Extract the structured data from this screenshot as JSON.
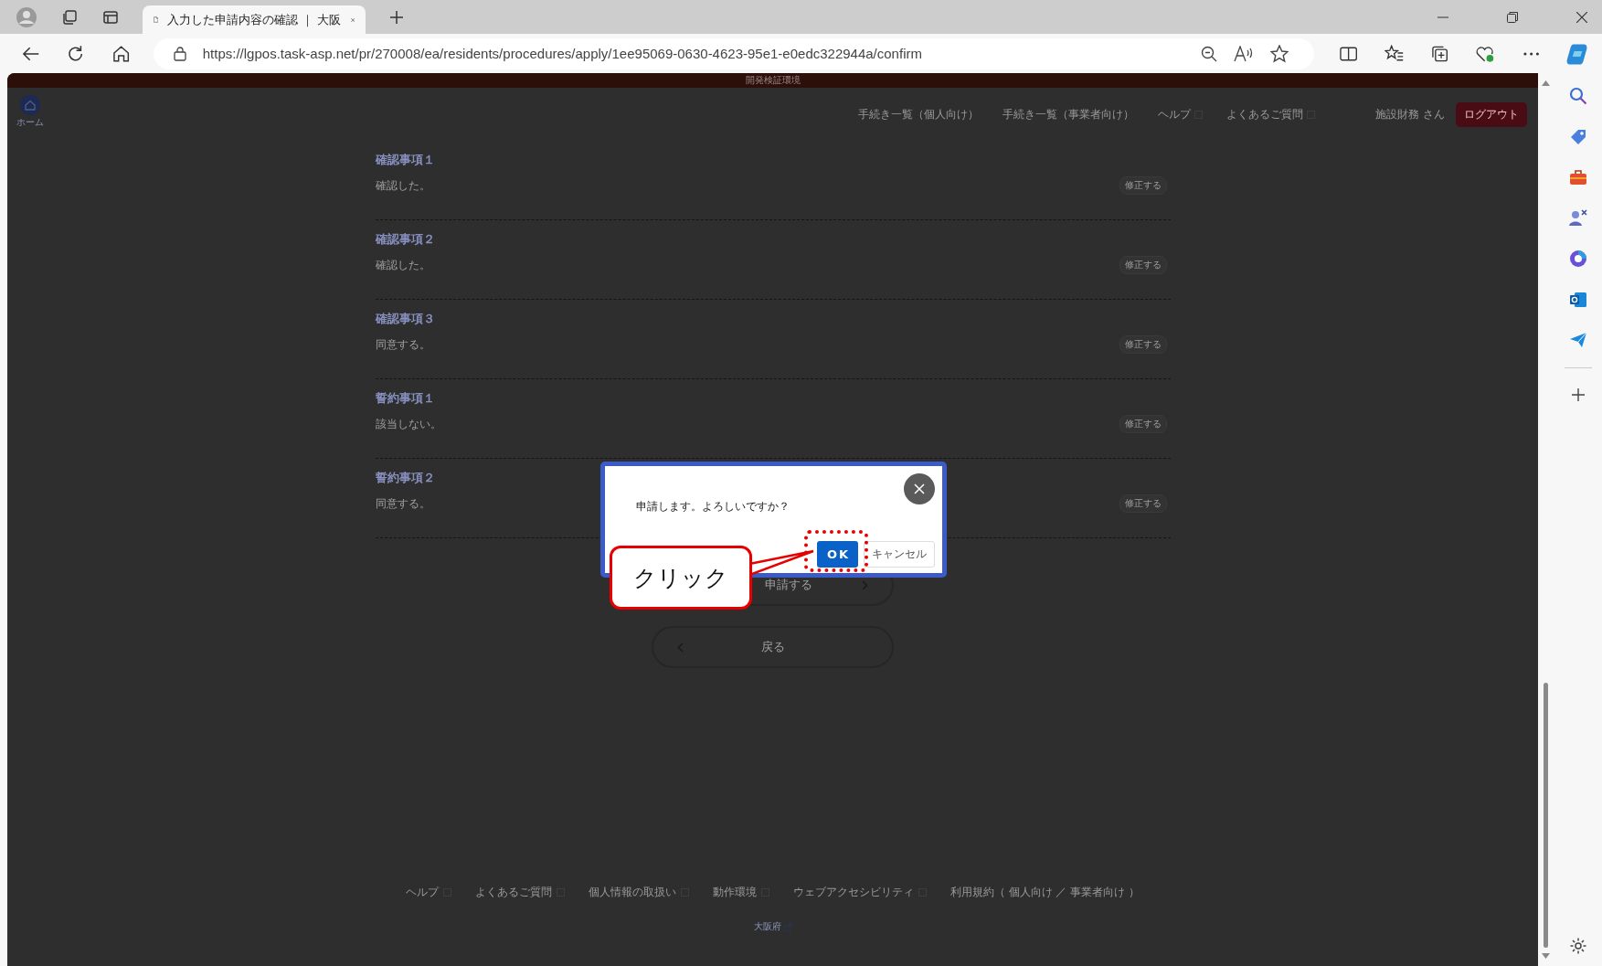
{
  "browser": {
    "tab_title": "入力した申請内容の確認 ｜ 大阪",
    "url": "https://lgpos.task-asp.net/pr/270008/ea/residents/procedures/apply/1ee95069-0630-4623-95e1-e0edc322944a/confirm"
  },
  "page": {
    "env_banner": "開発検証環境",
    "home_label": "ホーム",
    "nav": [
      {
        "label": "手続き一覧（個人向け）",
        "external": false
      },
      {
        "label": "手続き一覧（事業者向け）",
        "external": false
      },
      {
        "label": "ヘルプ",
        "external": true
      },
      {
        "label": "よくあるご質問",
        "external": true
      }
    ],
    "user": "施設財務 さん",
    "logout": "ログアウト",
    "items": [
      {
        "title": "確認事項１",
        "value": "確認した。",
        "edit": "修正する"
      },
      {
        "title": "確認事項２",
        "value": "確認した。",
        "edit": "修正する"
      },
      {
        "title": "確認事項３",
        "value": "同意する。",
        "edit": "修正する"
      },
      {
        "title": "誓約事項１",
        "value": "該当しない。",
        "edit": "修正する"
      },
      {
        "title": "誓約事項２",
        "value": "同意する。",
        "edit": "修正する"
      }
    ],
    "submit": "申請する",
    "back": "戻る",
    "footer_links": [
      {
        "label": "ヘルプ",
        "external": true
      },
      {
        "label": "よくあるご質問",
        "external": true
      },
      {
        "label": "個人情報の取扱い",
        "external": true
      },
      {
        "label": "動作環境",
        "external": true
      },
      {
        "label": "ウェブアクセシビリティ",
        "external": true
      },
      {
        "label": "利用規約（ 個人向け ／ 事業者向け ）",
        "external": false
      }
    ],
    "footer_org": "大阪府"
  },
  "dialog": {
    "message": "申請します。よろしいですか？",
    "ok": "OK",
    "cancel": "キャンセル"
  },
  "annotation": {
    "label": "クリック"
  }
}
